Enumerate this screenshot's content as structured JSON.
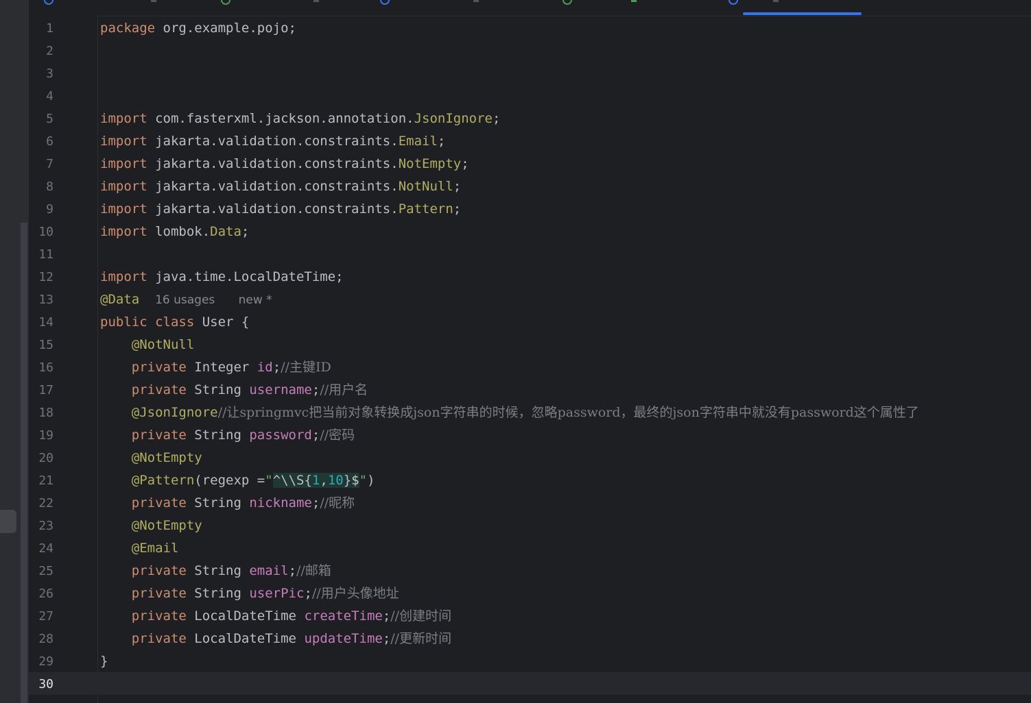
{
  "editor": {
    "line_numbers": [
      "1",
      "2",
      "3",
      "4",
      "5",
      "6",
      "7",
      "8",
      "9",
      "10",
      "11",
      "12",
      "13",
      "14",
      "15",
      "16",
      "17",
      "18",
      "19",
      "20",
      "21",
      "22",
      "23",
      "24",
      "25",
      "26",
      "27",
      "28",
      "29",
      "30"
    ],
    "code": {
      "l1_kw": "package",
      "l1_rest": " org.example.pojo;",
      "import_kw": "import",
      "l5_pkg": " com.fasterxml.jackson.annotation.",
      "l5_cls": "JsonIgnore",
      "semi": ";",
      "l6_pkg": " jakarta.validation.constraints.",
      "l6_cls": "Email",
      "l7_pkg": " jakarta.validation.constraints.",
      "l7_cls": "NotEmpty",
      "l8_pkg": " jakarta.validation.constraints.",
      "l8_cls": "NotNull",
      "l9_pkg": " jakarta.validation.constraints.",
      "l9_cls": "Pattern",
      "l10_pkg": " lombok.",
      "l10_cls": "Data",
      "l12_rest": " java.time.LocalDateTime;",
      "l13_ann": "@Data",
      "l13_usages": "16 usages",
      "l13_new": "new *",
      "l14_kw1": "public",
      "l14_kw2": "class",
      "l14_rest": " User {",
      "l15_ann": "@NotNull",
      "private_kw": "private",
      "l16_type": " Integer ",
      "l16_field": "id",
      "l16_tail": ";",
      "l16_cmt": "//主键ID",
      "l17_type": " String ",
      "l17_field": "username",
      "l17_tail": ";",
      "l17_cmt": "//用户名",
      "l18_ann": "@JsonIgnore",
      "l18_cmt": "//让springmvc把当前对象转换成json字符串的时候，忽略password，最终的json字符串中就没有password这个属性了",
      "l19_type": " String ",
      "l19_field": "password",
      "l19_tail": ";",
      "l19_cmt": "//密码",
      "l20_ann": "@NotEmpty",
      "l21_ann": "@Pattern",
      "l21_open": "(regexp =",
      "l21_q1": "\"",
      "l21_rx1": "^\\\\S",
      "l21_rx2": "{",
      "l21_n1": "1",
      "l21_comma": ",",
      "l21_n2": "10",
      "l21_rx3": "}",
      "l21_dollar": "$",
      "l21_q2": "\"",
      "l21_close": ")",
      "l22_type": " String ",
      "l22_field": "nickname",
      "l22_tail": ";",
      "l22_cmt": "//昵称",
      "l23_ann": "@NotEmpty",
      "l24_ann": "@Email",
      "l25_type": " String ",
      "l25_field": "email",
      "l25_tail": ";",
      "l25_cmt": "//邮箱",
      "l26_type": " String ",
      "l26_field": "userPic",
      "l26_tail": ";",
      "l26_cmt": "//用户头像地址",
      "l27_type": " LocalDateTime ",
      "l27_field": "createTime",
      "l27_tail": ";",
      "l27_cmt": "//创建时间",
      "l28_type": " LocalDateTime ",
      "l28_field": "updateTime",
      "l28_tail": ";",
      "l28_cmt": "//更新时间",
      "l29": "}"
    }
  },
  "colors": {
    "keyword": "#cf8e6d",
    "annotation": "#b3ae60",
    "field": "#c77dbb",
    "comment": "#7a7e85",
    "accent": "#3574f0"
  }
}
